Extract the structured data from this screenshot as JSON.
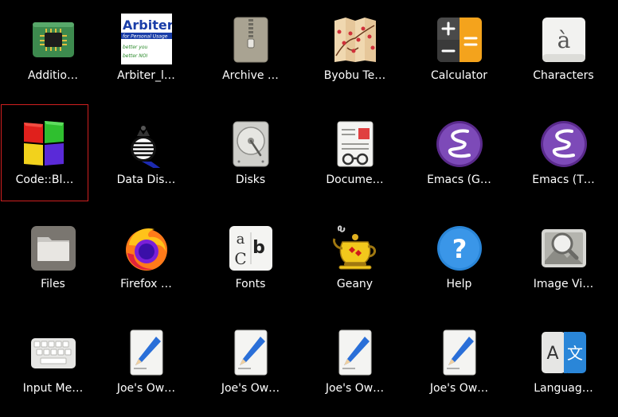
{
  "apps": [
    {
      "label": "Additio…",
      "icon": "cpu-chip-icon"
    },
    {
      "label": "Arbiter_l…",
      "icon": "arbiter-icon",
      "icon_text": {
        "title": "Arbiter",
        "subtitle": "for Personal Usage",
        "line1": "better you",
        "line2": "better NOI"
      }
    },
    {
      "label": "Archive …",
      "icon": "archive-zipper-icon"
    },
    {
      "label": "Byobu Te…",
      "icon": "byobu-screen-icon"
    },
    {
      "label": "Calculator",
      "icon": "calculator-icon"
    },
    {
      "label": "Characters",
      "icon": "characters-icon",
      "icon_glyph": "à"
    },
    {
      "label": "Code::Bl…",
      "icon": "codeblocks-icon",
      "selected": true
    },
    {
      "label": "Data Dis…",
      "icon": "data-display-icon"
    },
    {
      "label": "Disks",
      "icon": "disk-drive-icon"
    },
    {
      "label": "Docume…",
      "icon": "document-viewer-icon"
    },
    {
      "label": "Emacs (G…",
      "icon": "emacs-icon"
    },
    {
      "label": "Emacs (T…",
      "icon": "emacs-icon"
    },
    {
      "label": "Files",
      "icon": "folder-icon"
    },
    {
      "label": "Firefox …",
      "icon": "firefox-icon"
    },
    {
      "label": "Fonts",
      "icon": "fonts-icon",
      "icon_glyphs": [
        "a",
        "b",
        "C",
        "c"
      ]
    },
    {
      "label": "Geany",
      "icon": "geany-teapot-icon"
    },
    {
      "label": "Help",
      "icon": "help-icon",
      "icon_glyph": "?"
    },
    {
      "label": "Image Vi…",
      "icon": "image-viewer-icon"
    },
    {
      "label": "Input Me…",
      "icon": "keyboard-icon"
    },
    {
      "label": "Joe's Ow…",
      "icon": "text-editor-icon"
    },
    {
      "label": "Joe's Ow…",
      "icon": "text-editor-icon"
    },
    {
      "label": "Joe's Ow…",
      "icon": "text-editor-icon"
    },
    {
      "label": "Joe's Ow…",
      "icon": "text-editor-icon"
    },
    {
      "label": "Languag…",
      "icon": "language-icon",
      "icon_glyphs": [
        "A",
        "文"
      ]
    }
  ],
  "colors": {
    "background": "#000000",
    "selection_border": "#d02020",
    "label": "#ffffff"
  }
}
